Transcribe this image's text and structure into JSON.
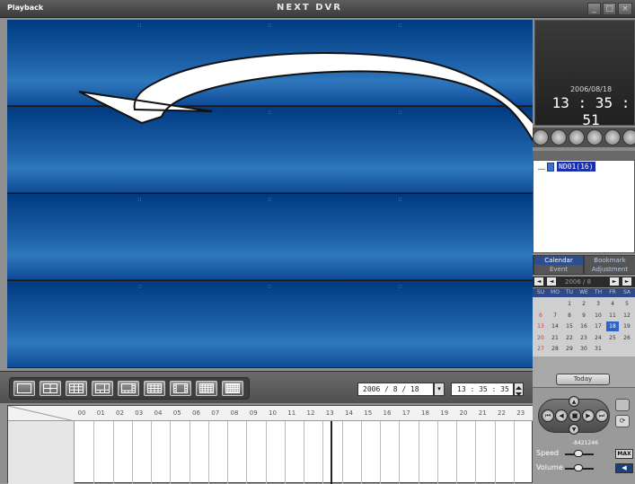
{
  "titlebar": {
    "app_name": "Playback",
    "window_title": "NEXT DVR",
    "minimize": "_",
    "maximize": "□",
    "close": "×"
  },
  "video": {
    "pane_count": 4,
    "pane_separator": "::"
  },
  "layout_buttons": [
    "1x1",
    "2x2",
    "3x3",
    "1+5",
    "1+7",
    "4x4",
    "1+12",
    "5x5",
    "6x6"
  ],
  "search": {
    "date": "2006 / 8 / 18",
    "date_dropdown": "▾",
    "time": "13 : 35 : 35"
  },
  "timeline": {
    "hours": [
      "00",
      "01",
      "02",
      "03",
      "04",
      "05",
      "06",
      "07",
      "08",
      "09",
      "10",
      "11",
      "12",
      "13",
      "14",
      "15",
      "16",
      "17",
      "18",
      "19",
      "20",
      "21",
      "22",
      "23"
    ]
  },
  "clock": {
    "date": "2006/08/18",
    "time": "13 : 35 : 51"
  },
  "tree": {
    "node_label": "ND01(16)"
  },
  "tabs": {
    "calendar": "Calendar",
    "bookmark": "Bookmark",
    "event": "Event",
    "adjustment": "Adjustment"
  },
  "calendar": {
    "month_label": "2006 / 8",
    "nav_prev2": "◄",
    "nav_prev": "◄",
    "nav_next": "►",
    "nav_next2": "►",
    "weekdays": [
      "SU",
      "MO",
      "TU",
      "WE",
      "TH",
      "FR",
      "SA"
    ],
    "weeks": [
      [
        "",
        "",
        "1",
        "2",
        "3",
        "4",
        "5"
      ],
      [
        "6",
        "7",
        "8",
        "9",
        "10",
        "11",
        "12"
      ],
      [
        "13",
        "14",
        "15",
        "16",
        "17",
        "18",
        "19"
      ],
      [
        "20",
        "21",
        "22",
        "23",
        "24",
        "25",
        "26"
      ],
      [
        "27",
        "28",
        "29",
        "30",
        "31",
        "",
        ""
      ]
    ],
    "selected_day": "18",
    "today_label": "Today"
  },
  "player": {
    "speed_label": "Speed",
    "volume_label": "Volume",
    "speed_scale": "-8421246",
    "max_label": "MAX",
    "play": "▶",
    "stop": "■",
    "rewind": "◀",
    "prev": "⏮",
    "next": "⏭",
    "step_up": "▲",
    "step_down": "▼",
    "refresh": "⟳",
    "volume_icon": "◀"
  },
  "colors": {
    "pane_dark": "#003a80",
    "pane_light": "#2f78bd",
    "selection": "#2b63c8"
  }
}
